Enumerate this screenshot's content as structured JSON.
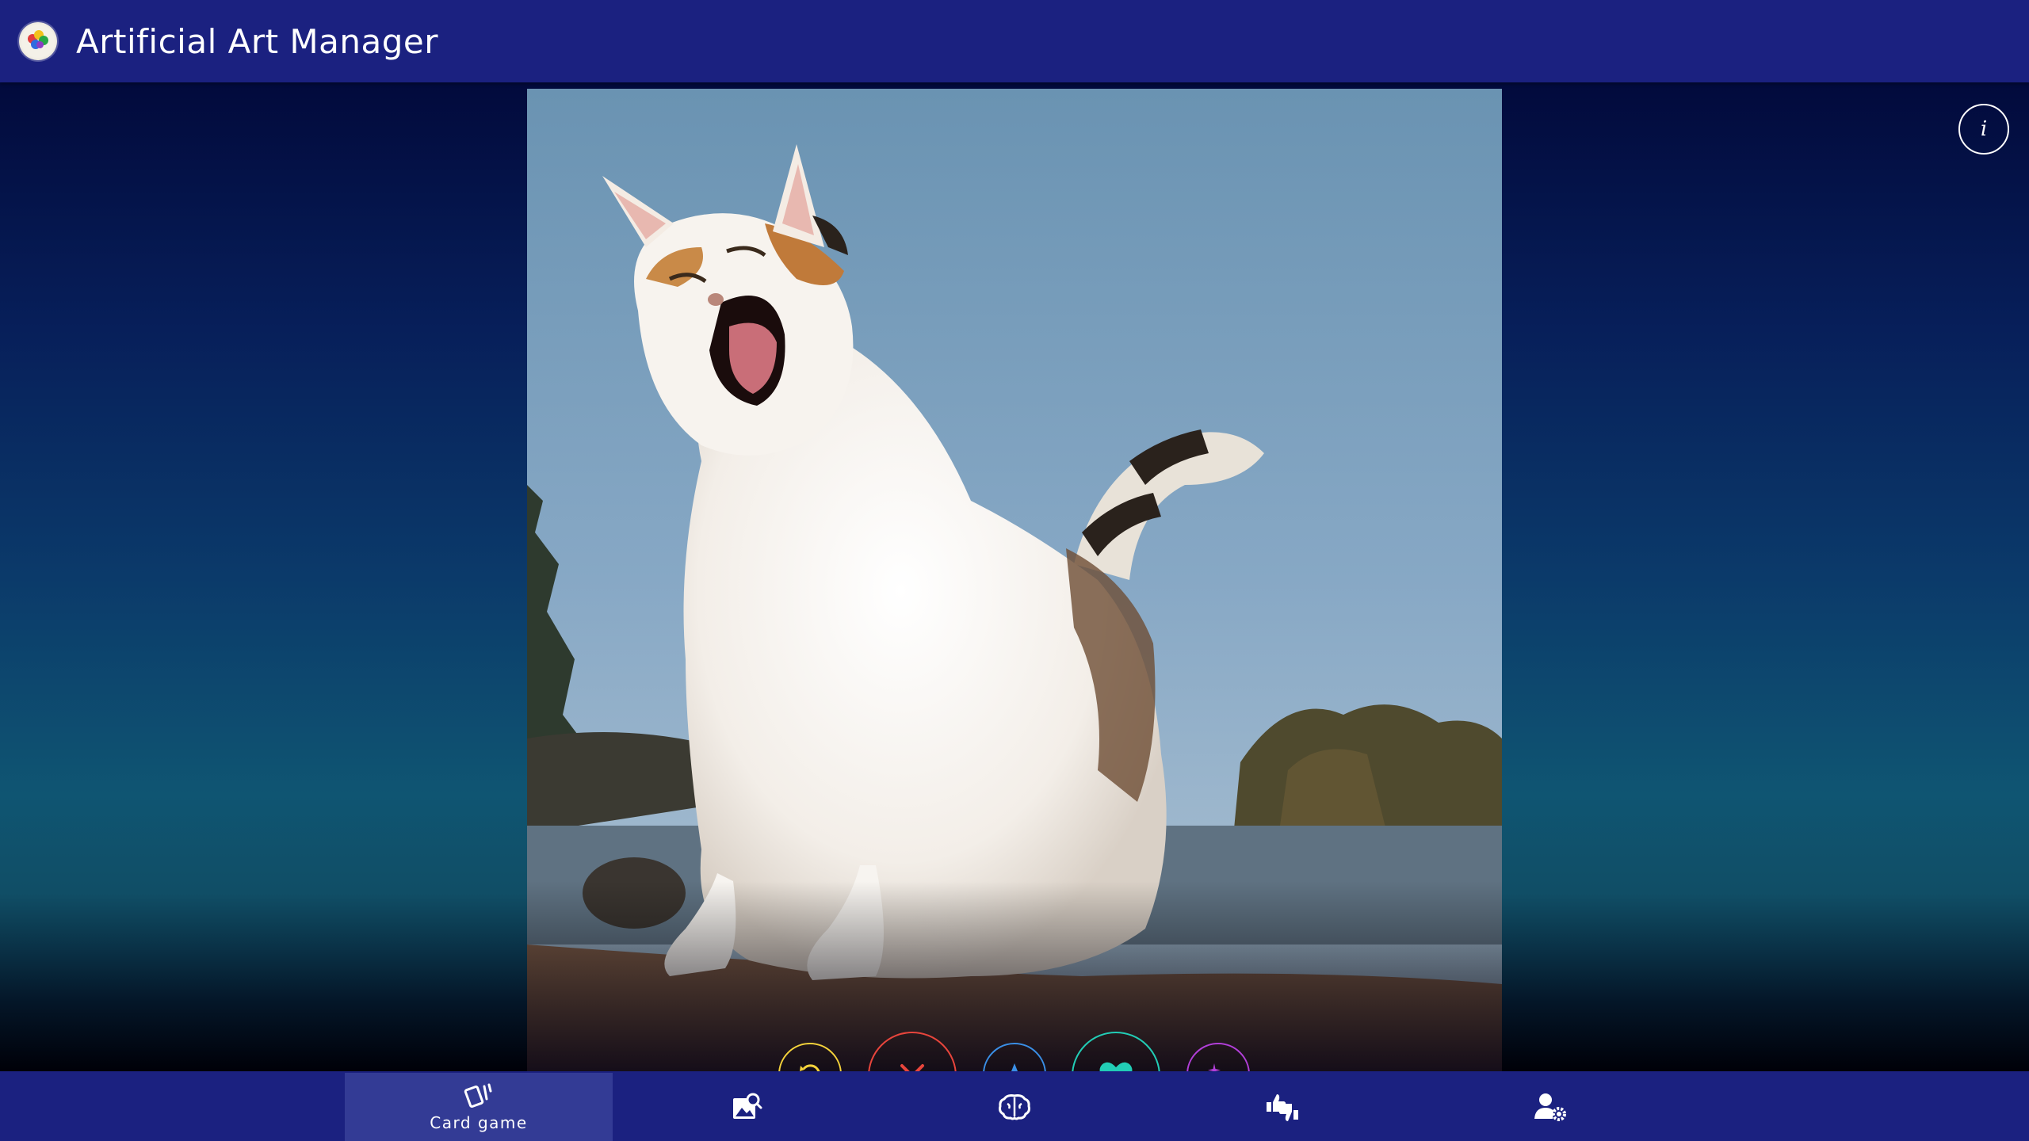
{
  "header": {
    "title": "Artificial Art Manager",
    "logo_icon": "palette-logo-icon"
  },
  "artwork": {
    "subject": "cat-photo",
    "info_icon_text": "i"
  },
  "actions": [
    {
      "name": "rewind",
      "icon": "rewind-icon",
      "color": "#f5d33b"
    },
    {
      "name": "nope",
      "icon": "close-icon",
      "color": "#e8453c"
    },
    {
      "name": "super-like",
      "icon": "star-icon",
      "color": "#3a8fe6"
    },
    {
      "name": "like",
      "icon": "heart-icon",
      "color": "#22cdb6"
    },
    {
      "name": "boost",
      "icon": "sparkles-icon",
      "color": "#b23fd9"
    }
  ],
  "nav": {
    "active_index": 0,
    "items": [
      {
        "label": "Card game",
        "icon": "cards-icon"
      },
      {
        "label": "",
        "icon": "image-search-icon"
      },
      {
        "label": "",
        "icon": "brain-icon"
      },
      {
        "label": "",
        "icon": "thumbs-up-down-icon"
      },
      {
        "label": "",
        "icon": "user-settings-icon"
      }
    ]
  },
  "colors": {
    "header_bg": "#1b2180",
    "nav_active_bg": "#333b95",
    "text": "#ffffff"
  }
}
